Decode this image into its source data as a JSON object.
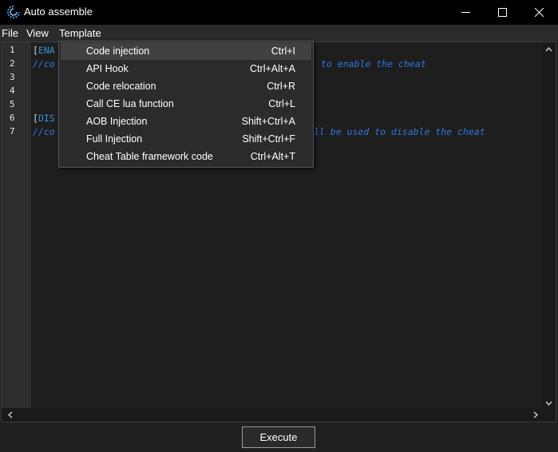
{
  "window": {
    "title": "Auto assemble",
    "icon": "cheat-engine-icon"
  },
  "menu": {
    "file": "File",
    "view": "View",
    "template": "Template"
  },
  "editor": {
    "line_numbers": [
      "1",
      "2",
      "3",
      "4",
      "5",
      "6",
      "7"
    ],
    "lines": [
      {
        "bracket_open": "[",
        "label": "ENA"
      },
      {
        "comment_prefix": "//co",
        "comment_suffix": "to enable the cheat"
      },
      {},
      {},
      {},
      {
        "bracket_open": "[",
        "label": "DIS"
      },
      {
        "comment_prefix": "//co",
        "comment_suffix": "ll be used to disable the cheat"
      }
    ]
  },
  "template_menu": {
    "items": [
      {
        "label": "Code injection",
        "shortcut": "Ctrl+I"
      },
      {
        "label": "API Hook",
        "shortcut": "Ctrl+Alt+A"
      },
      {
        "label": "Code relocation",
        "shortcut": "Ctrl+R"
      },
      {
        "label": "Call CE lua function",
        "shortcut": "Ctrl+L"
      },
      {
        "label": "AOB Injection",
        "shortcut": "Shift+Ctrl+A"
      },
      {
        "label": "Full Injection",
        "shortcut": "Shift+Ctrl+F"
      },
      {
        "label": "Cheat Table framework code",
        "shortcut": "Ctrl+Alt+T"
      }
    ]
  },
  "footer": {
    "execute_label": "Execute"
  },
  "colors": {
    "comment": "#2f77d6",
    "label": "#3d8fd0",
    "background": "#1e1e1e"
  }
}
